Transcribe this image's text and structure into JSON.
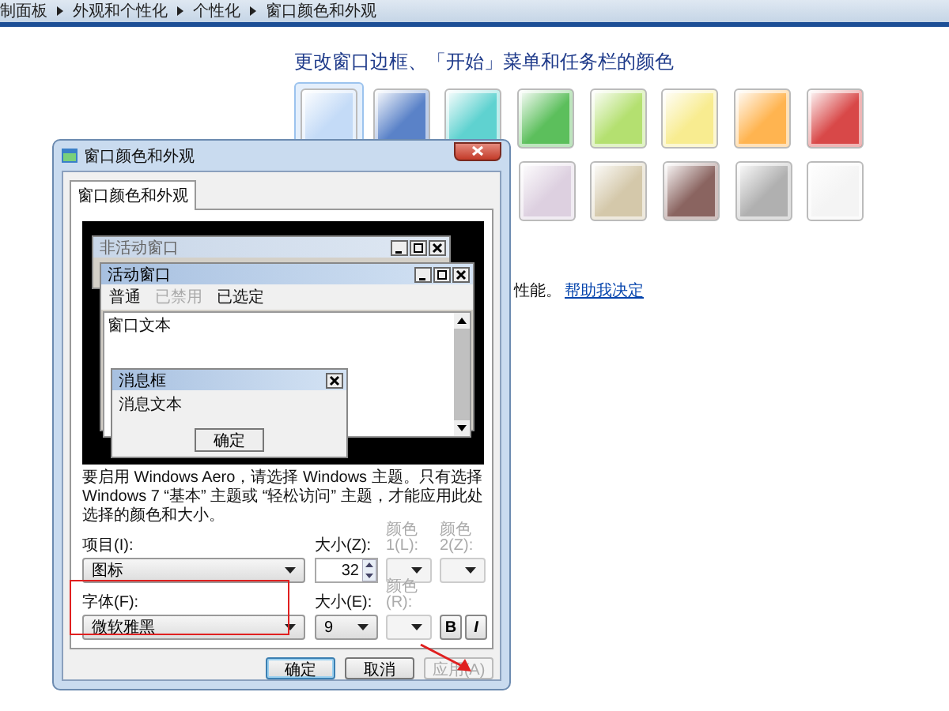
{
  "breadcrumb": [
    "制面板",
    "外观和个性化",
    "个性化",
    "窗口颜色和外观"
  ],
  "heading": "更改窗口边框、「开始」菜单和任务栏的颜色",
  "swatches_row_1": [
    {
      "color": "#c4dbf7",
      "selected": true
    },
    {
      "color": "#5a82c8",
      "selected": false
    },
    {
      "color": "#5fd2d0",
      "selected": false
    },
    {
      "color": "#5cbf5c",
      "selected": false
    },
    {
      "color": "#b4e070",
      "selected": false
    },
    {
      "color": "#f8ec90",
      "selected": false
    },
    {
      "color": "#ffb450",
      "selected": false
    },
    {
      "color": "#d84848",
      "selected": false
    }
  ],
  "swatches_row_2": [
    {
      "color": "#ddd0e0",
      "selected": false
    },
    {
      "color": "#d4c8aa",
      "selected": false
    },
    {
      "color": "#8a6460",
      "selected": false
    },
    {
      "color": "#b0b0b0",
      "selected": false
    },
    {
      "color": "#f4f4f4",
      "selected": false
    }
  ],
  "hint": {
    "text": "性能。",
    "link": "帮助我决定"
  },
  "dialog": {
    "title": "窗口颜色和外观",
    "tabs": [
      {
        "label": "窗口颜色和外观",
        "selected": true
      }
    ],
    "preview": {
      "inactive_window": {
        "title": "非活动窗口"
      },
      "active_window": {
        "title": "活动窗口",
        "menu": [
          {
            "label": "普通",
            "disabled": false
          },
          {
            "label": "已禁用",
            "disabled": true
          },
          {
            "label": "已选定",
            "disabled": false
          }
        ],
        "text": "窗口文本"
      },
      "message_box": {
        "title": "消息框",
        "text": "消息文本",
        "button": "确定"
      }
    },
    "description": "要启用 Windows Aero，请选择 Windows 主题。只有选择 Windows 7 “基本” 主题或 “轻松访问” 主题，才能应用此处选择的颜色和大小。",
    "item": {
      "label": "项目(I):",
      "value": "图标"
    },
    "item_size": {
      "label": "大小(Z):",
      "value": "32"
    },
    "color_1": {
      "label": "颜色 1(L):",
      "disabled": true
    },
    "color_2": {
      "label": "颜色 2(Z):",
      "disabled": true
    },
    "font": {
      "label": "字体(F):",
      "value": "微软雅黑"
    },
    "font_size": {
      "label": "大小(E):",
      "value": "9"
    },
    "font_color": {
      "label": "颜色(R):",
      "disabled": true
    },
    "bold": {
      "label": "B",
      "selected": false
    },
    "italic": {
      "label": "I",
      "selected": false
    },
    "buttons": [
      {
        "label": "确定",
        "default": true,
        "disabled": false
      },
      {
        "label": "取消",
        "default": false,
        "disabled": false
      },
      {
        "label": "应用(A)",
        "default": false,
        "disabled": true
      }
    ]
  }
}
